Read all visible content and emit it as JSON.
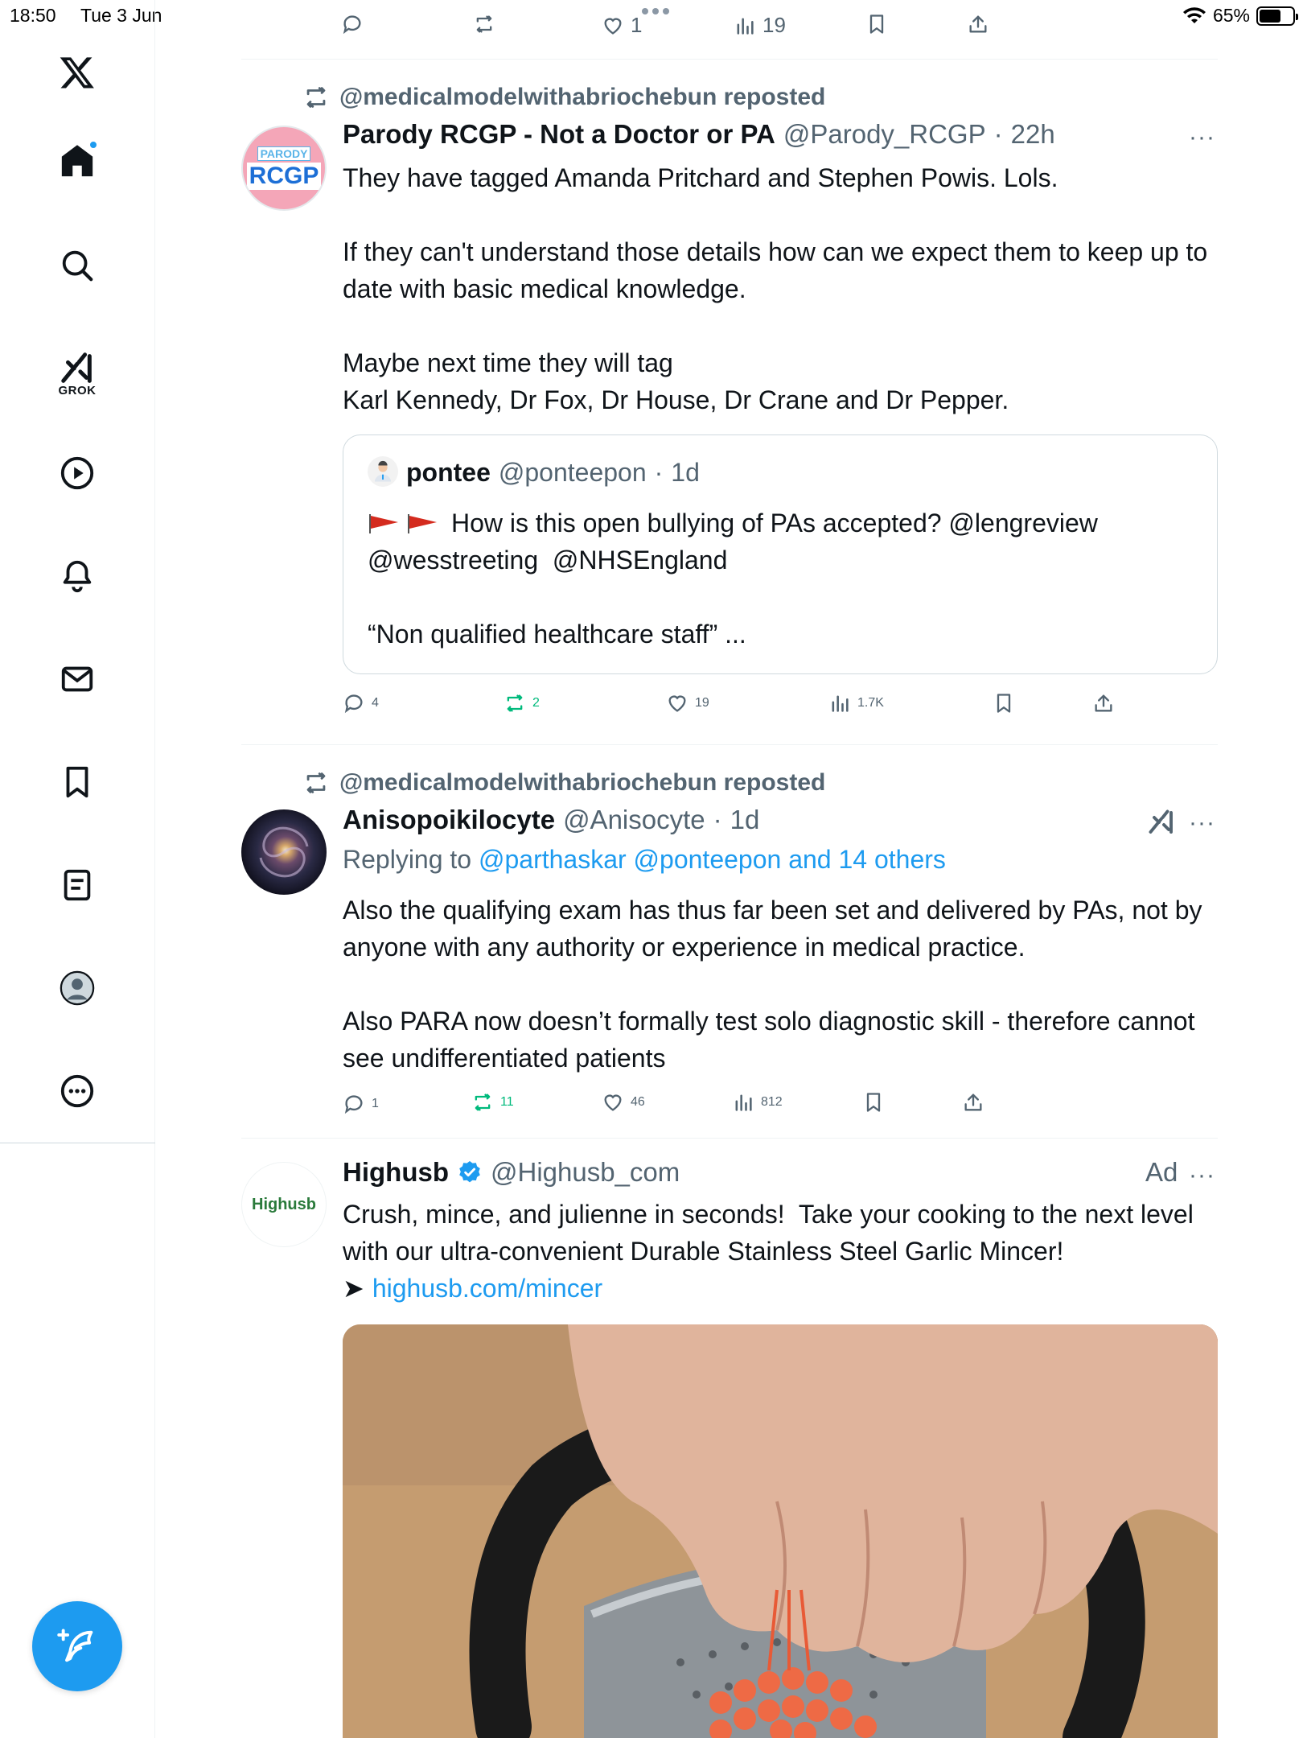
{
  "status_bar": {
    "time": "18:50",
    "date": "Tue 3 Jun",
    "battery": "65%",
    "battery_level": 0.65
  },
  "sidebar": {
    "grok_label": "GROK"
  },
  "top_actions": {
    "likes": "1",
    "views": "19"
  },
  "tweet1": {
    "repost_text": "@medicalmodelwithabriochebun reposted",
    "avatar_top": "PARODY",
    "avatar_main": "RCGP",
    "name": "Parody RCGP - Not a Doctor or PA",
    "handle": "@Parody_RCGP",
    "time": "22h",
    "more": "···",
    "body": "They have tagged Amanda Pritchard and Stephen Powis. Lols.\n\nIf they can't understand those details how can we expect them to keep up to date with basic medical knowledge.\n\nMaybe next time they will tag\nKarl Kennedy, Dr Fox, Dr House, Dr Crane and Dr Pepper.",
    "quote": {
      "name": "pontee",
      "handle": "@ponteepon",
      "time": "1d",
      "line1": "How is this open bullying of PAs accepted? @lengreview",
      "line2": "@wesstreeting  @NHSEngland",
      "line3": "“Non qualified healthcare staff” ..."
    },
    "replies": "4",
    "reposts": "2",
    "likes": "19",
    "views": "1.7K"
  },
  "tweet2": {
    "repost_text": "@medicalmodelwithabriochebun reposted",
    "name": "Anisopoikilocyte",
    "handle": "@Anisocyte",
    "time": "1d",
    "more": "···",
    "replying_prefix": "Replying to ",
    "replying_to": "@parthaskar @ponteepon and 14 others",
    "body": "Also the qualifying exam has thus far been set and delivered by PAs, not by anyone with any authority or experience in medical practice.\n\nAlso PARA now doesn’t formally test solo diagnostic skill - therefore cannot see undifferentiated patients",
    "replies": "1",
    "reposts": "11",
    "likes": "46",
    "views": "812"
  },
  "ad": {
    "avatar_text": "Highusb",
    "name": "Highusb",
    "handle": "@Highusb_com",
    "ad_label": "Ad",
    "more": "···",
    "body": "Crush, mince, and julienne in seconds!  Take your cooking to the next level with our ultra-convenient Durable Stainless Steel Garlic Mincer!",
    "arrow": "➤",
    "link": "highusb.com/mincer"
  },
  "colors": {
    "accent": "#1d9bf0",
    "repost_green": "#00ba7c",
    "secondary_text": "#536471",
    "avatar_pink": "#f4a6b8"
  }
}
